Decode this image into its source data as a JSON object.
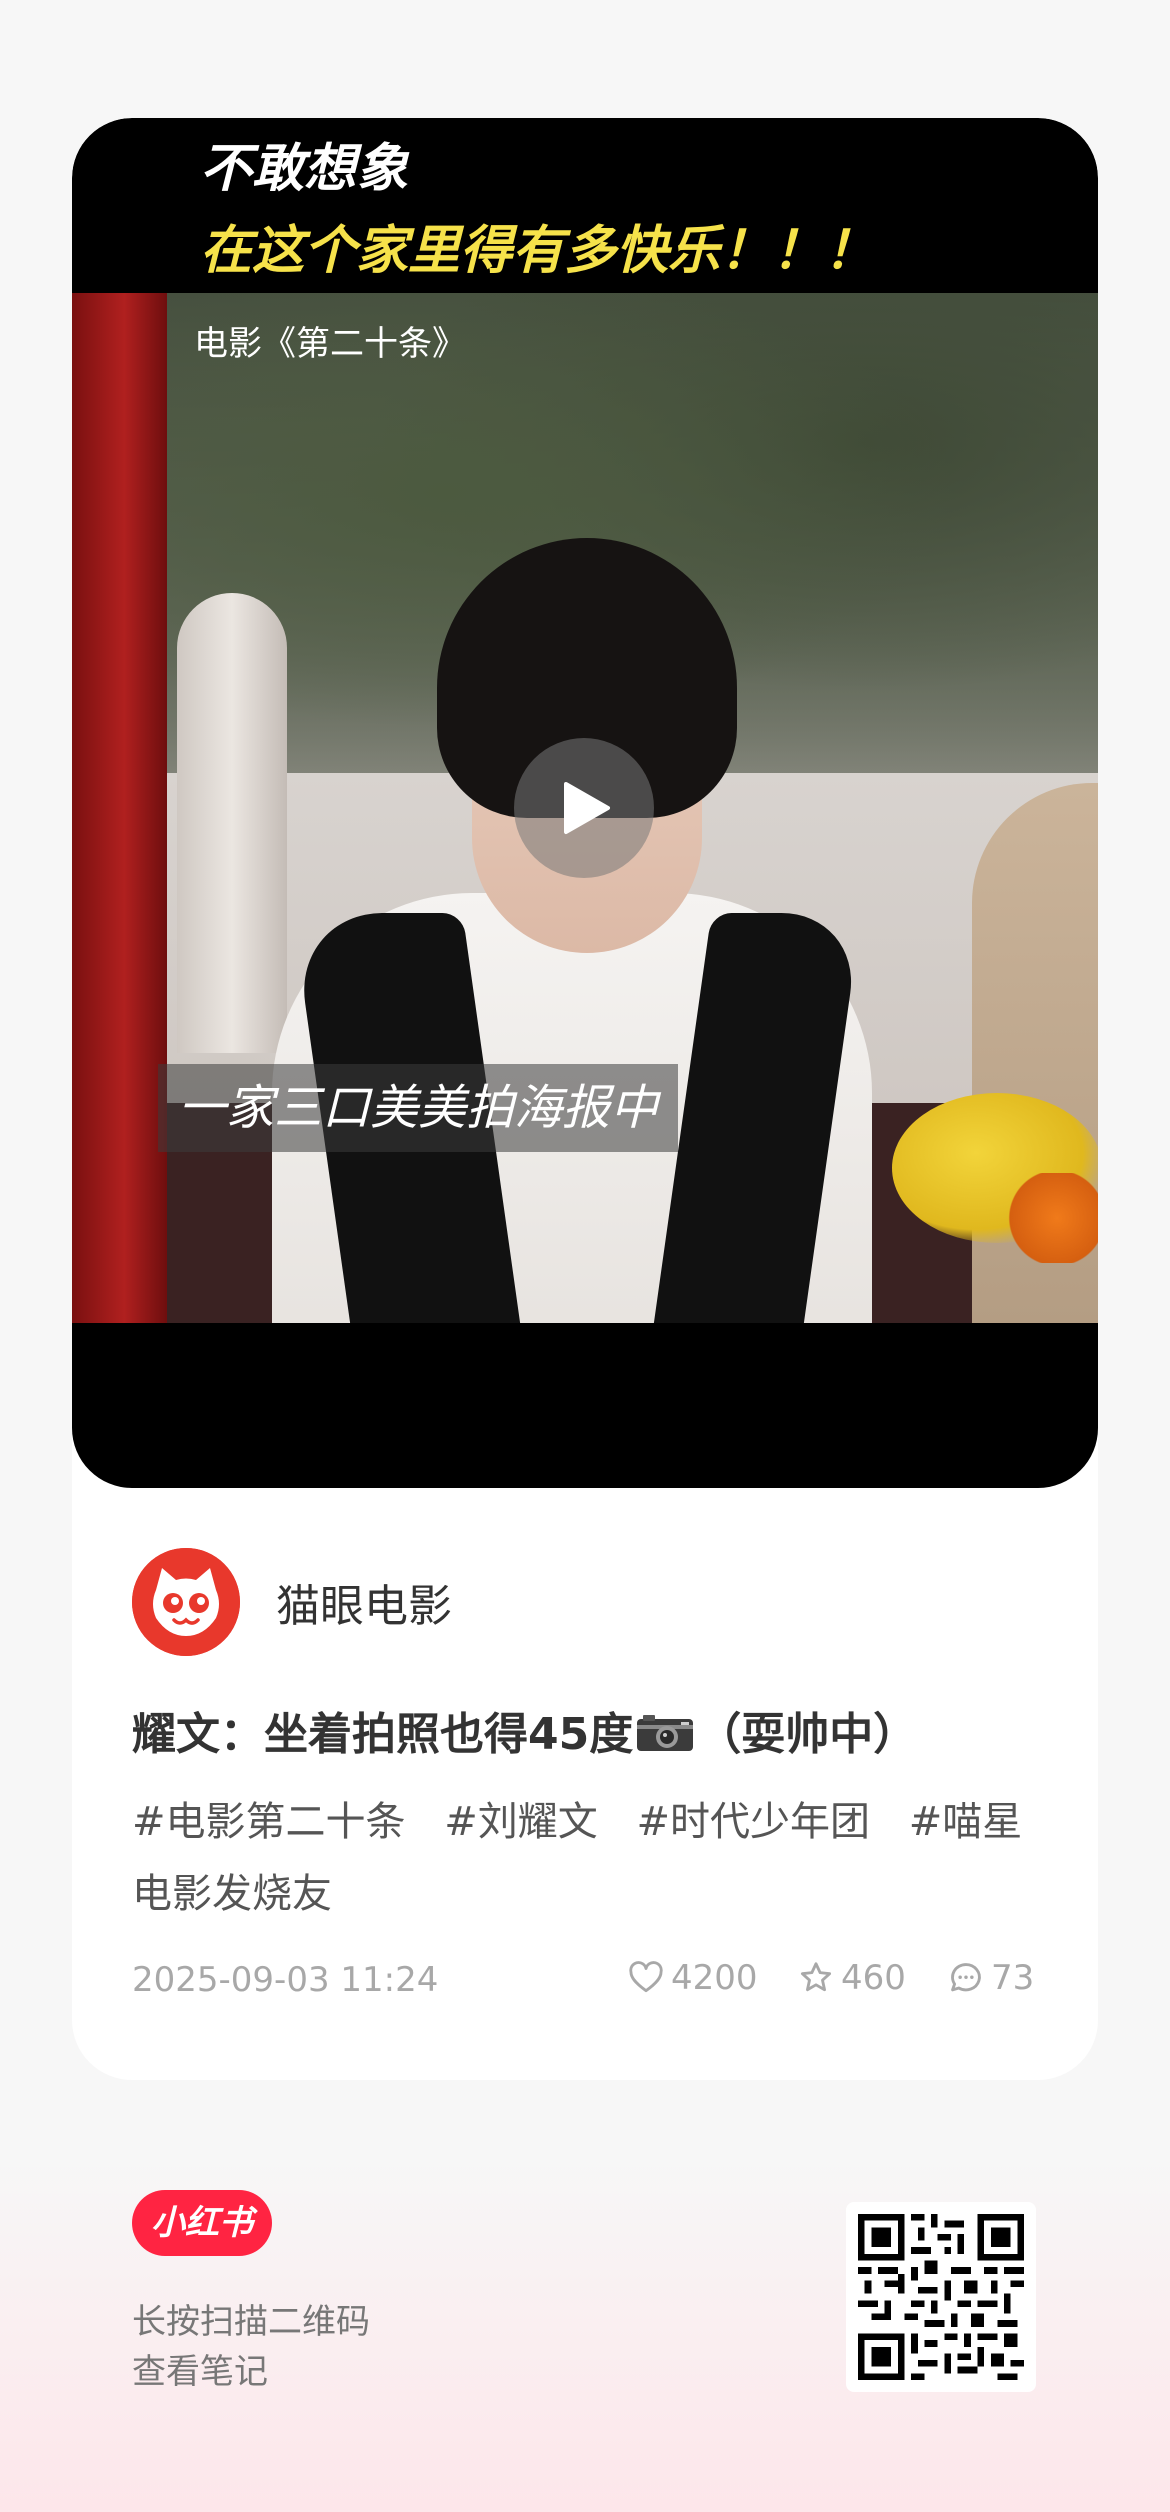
{
  "video": {
    "overlay_title_line1": "不敢想象",
    "overlay_title_line2": "在这个家里得有多快乐！！！",
    "caption": "电影《第二十条》",
    "subtitle": "一家三口美美拍海报中",
    "play_icon": "play-icon"
  },
  "author": {
    "name": "猫眼电影",
    "avatar_icon": "cat-logo-icon",
    "avatar_color": "#e8382c"
  },
  "post": {
    "title_prefix": "耀文：坐着拍照也得45度",
    "title_emoji": "camera-icon",
    "title_suffix": "（耍帅中）",
    "tags": [
      "#电影第二十条",
      "#刘耀文",
      "#时代少年团",
      "#喵星电影发烧友"
    ],
    "time": "2025-09-03 11:24",
    "likes": "4200",
    "collects": "460",
    "comments": "73"
  },
  "footer": {
    "logo_text": "小红书",
    "logo_color": "#ff2442",
    "scan_line1": "长按扫描二维码",
    "scan_line2": "查看笔记",
    "qr_icon": "qr-code-icon"
  }
}
